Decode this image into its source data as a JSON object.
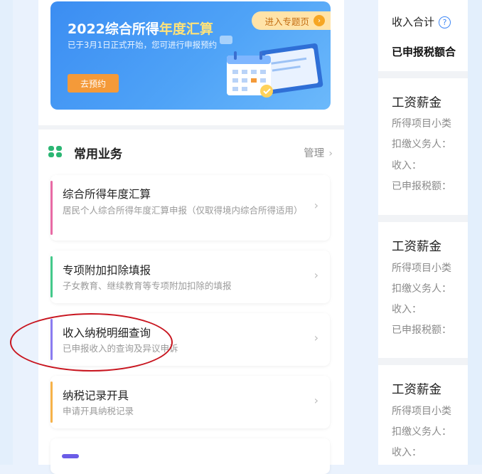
{
  "banner": {
    "title_prefix": "2022综合所得",
    "title_highlight": "年度汇算",
    "description": "已于3月1日正式开始，您可进行申报预约",
    "button": "去预约",
    "tag": "进入专题页"
  },
  "section": {
    "title": "常用业务",
    "manage": "管理"
  },
  "cards": [
    {
      "title": "综合所得年度汇算",
      "subtitle": "居民个人综合所得年度汇算申报（仅取得境内综合所得适用）",
      "accent": "#e86aa5"
    },
    {
      "title": "专项附加扣除填报",
      "subtitle": "子女教育、继续教育等专项附加扣除的填报",
      "accent": "#43c98a"
    },
    {
      "title": "收入纳税明细查询",
      "subtitle": "已申报收入的查询及异议申诉",
      "accent": "#8a7cf0"
    },
    {
      "title": "纳税记录开具",
      "subtitle": "申请开具纳税记录",
      "accent": "#f6b24a"
    }
  ],
  "right_panel": {
    "income_total": "收入合计",
    "declared_tax_total": "已申报税额合",
    "records": [
      {
        "title": "工资薪金",
        "category": "所得项目小类",
        "withholder": "扣缴义务人：",
        "income": "收入：",
        "declared_tax": "已申报税额："
      },
      {
        "title": "工资薪金",
        "category": "所得项目小类",
        "withholder": "扣缴义务人：",
        "income": "收入：",
        "declared_tax": "已申报税额："
      },
      {
        "title": "工资薪金",
        "category": "所得项目小类",
        "withholder": "扣缴义务人：",
        "income": "收入："
      }
    ]
  },
  "colors": {
    "brand_blue": "#3b8df2",
    "button_orange": "#f49a39",
    "highlight_yellow": "#ffe37a",
    "section_icon_green": "#2bb673",
    "annotation_red": "#c8151f"
  }
}
